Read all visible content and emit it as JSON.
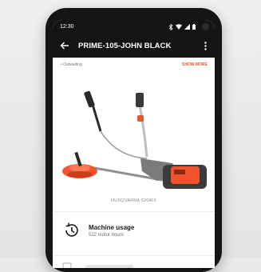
{
  "status_bar": {
    "time": "12:30",
    "icons": [
      "bluetooth-icon",
      "wifi-icon",
      "signal-icon",
      "battery-icon"
    ]
  },
  "app_bar": {
    "title": "PRIME-105-JOHN BLACK",
    "back_icon": "arrow-left-icon",
    "more_icon": "more-vertical-icon"
  },
  "info_row": {
    "left_text": "• Outwaiting",
    "right_link": "SHOW MORE"
  },
  "product": {
    "caption": "HUSQVARNA 520iRX",
    "image": "trimmer-illustration"
  },
  "machine_usage": {
    "label": "Machine usage",
    "value": "522 motor hours",
    "icon": "history-icon"
  },
  "colors": {
    "accent": "#e4572e",
    "bar": "#141414",
    "product_orange": "#f0532d"
  }
}
